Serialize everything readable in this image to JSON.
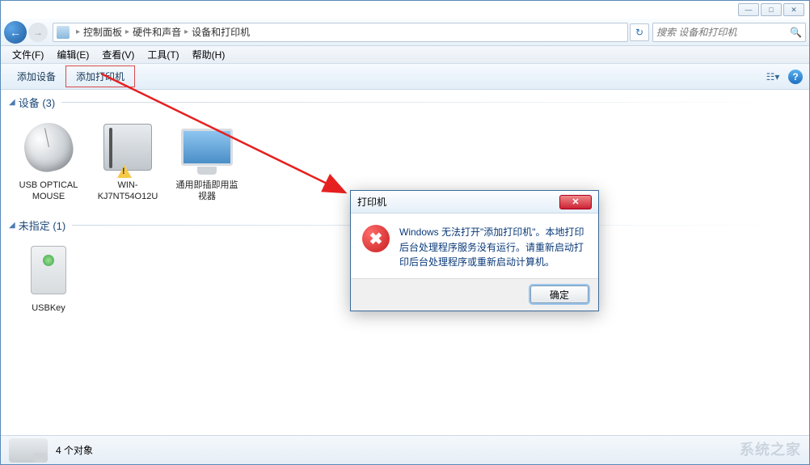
{
  "window_controls": {
    "min": "—",
    "max": "□",
    "close": "✕"
  },
  "breadcrumb": {
    "dropdown": "▸",
    "items": [
      "控制面板",
      "硬件和声音",
      "设备和打印机"
    ]
  },
  "search": {
    "placeholder": "搜索 设备和打印机"
  },
  "menu": {
    "items": [
      "文件(F)",
      "编辑(E)",
      "查看(V)",
      "工具(T)",
      "帮助(H)"
    ]
  },
  "toolbar": {
    "add_device": "添加设备",
    "add_printer": "添加打印机"
  },
  "groups": {
    "devices": {
      "label": "设备 (3)"
    },
    "unspecified": {
      "label": "未指定 (1)"
    }
  },
  "devices": [
    {
      "name": "USB OPTICAL MOUSE",
      "kind": "mouse"
    },
    {
      "name": "WIN-KJ7NT54O12U",
      "kind": "pc",
      "warning": true
    },
    {
      "name": "通用即插即用监视器",
      "kind": "monitor"
    }
  ],
  "unspecified": [
    {
      "name": "USBKey",
      "kind": "usbkey"
    }
  ],
  "status_bar": {
    "count_label": "4 个对象"
  },
  "dialog": {
    "title": "打印机",
    "message": "Windows 无法打开\"添加打印机\"。本地打印后台处理程序服务没有运行。请重新启动打印后台处理程序或重新启动计算机。",
    "ok": "确定"
  },
  "watermark": "系统之家"
}
